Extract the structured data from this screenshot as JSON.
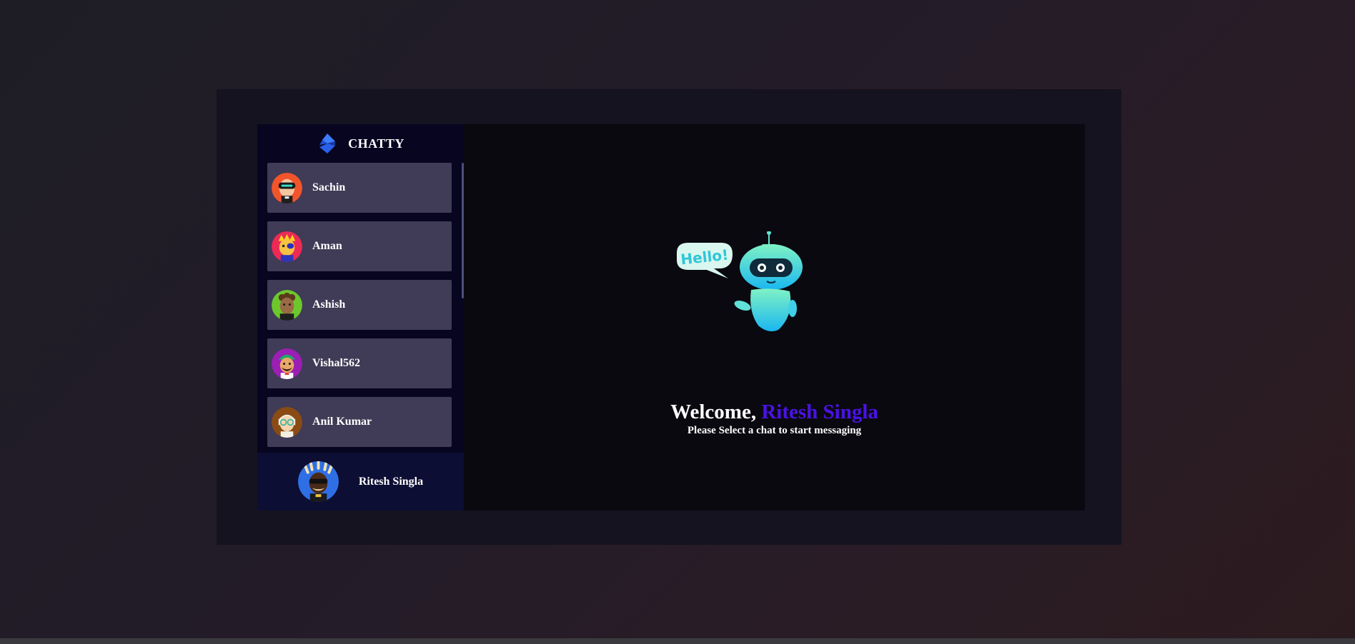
{
  "brand": {
    "name": "CHATTY",
    "logo_icon": "diamond-logo-icon",
    "logo_color": "#2f6bff"
  },
  "contacts": [
    {
      "name": "Sachin",
      "avatar_icon": "vr-headset-avatar-icon",
      "avatar_bg": "#f2552c"
    },
    {
      "name": "Aman",
      "avatar_icon": "eyepatch-avatar-icon",
      "avatar_bg": "#ec2a55"
    },
    {
      "name": "Ashish",
      "avatar_icon": "curly-hair-avatar-icon",
      "avatar_bg": "#6cc72c"
    },
    {
      "name": "Vishal562",
      "avatar_icon": "turban-avatar-icon",
      "avatar_bg": "#9b1fb4"
    },
    {
      "name": "Anil Kumar",
      "avatar_icon": "glasses-avatar-icon",
      "avatar_bg": "#8a4b14"
    }
  ],
  "current_user": {
    "name": "Ritesh Singla",
    "avatar_icon": "dreadlocks-avatar-icon",
    "avatar_bg": "#2f6fe6"
  },
  "welcome": {
    "greeting": "Welcome, ",
    "user_name": "Ritesh Singla",
    "subtitle": "Please Select a chat to start messaging",
    "robot_bubble_text": "Hello!",
    "accent_color": "#4a12e6"
  }
}
